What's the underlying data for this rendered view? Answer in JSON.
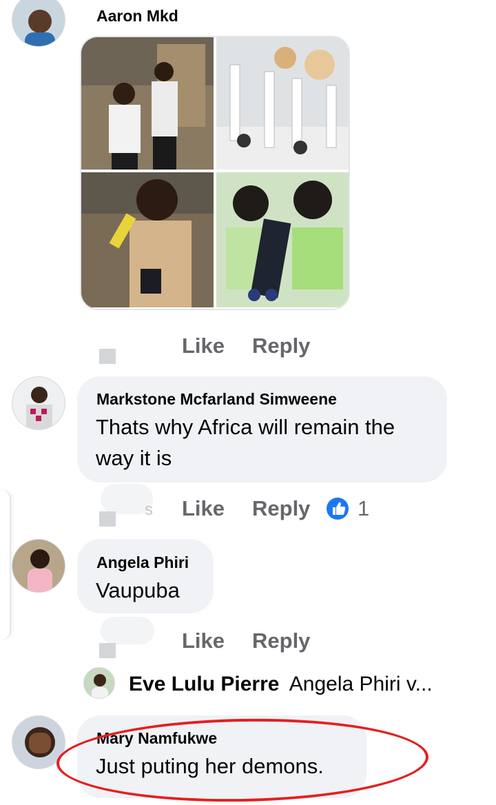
{
  "comments": [
    {
      "author": "Aaron Mkd",
      "actions": {
        "like": "Like",
        "reply": "Reply"
      }
    },
    {
      "author": "Markstone Mcfarland Simweene",
      "text_line1": "Thats why Africa will remain the",
      "text_line2": "way it is",
      "actions": {
        "like": "Like",
        "reply": "Reply"
      },
      "reaction_count": "1",
      "faded_prefix": "s"
    },
    {
      "author": "Angela Phiri",
      "text": "Vaupuba",
      "actions": {
        "like": "Like",
        "reply": "Reply"
      }
    },
    {
      "author": "Mary Namfukwe",
      "text": "Just puting her demons."
    }
  ],
  "reply_preview": {
    "author": "Eve Lulu Pierre",
    "text": "Angela Phiri v..."
  },
  "colors": {
    "bubble": "#f0f2f5",
    "action_text": "#65676b",
    "like_blue": "#1a77f2",
    "highlight_red": "#e51f1f"
  },
  "icons": [
    "thumbs-up-reaction-icon"
  ]
}
